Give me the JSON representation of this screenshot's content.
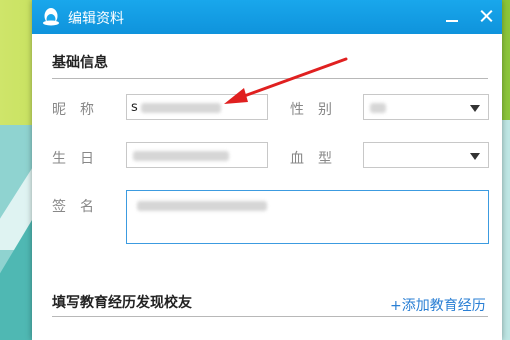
{
  "window": {
    "title": "编辑资料"
  },
  "basic_info": {
    "heading": "基础信息",
    "nickname": {
      "label": "昵　称",
      "value": "s"
    },
    "gender": {
      "label": "性　别"
    },
    "birthday": {
      "label": "生　日"
    },
    "blood_type": {
      "label": "血　型"
    },
    "signature": {
      "label": "签　名"
    }
  },
  "education": {
    "heading": "填写教育经历发现校友",
    "add_link": "+添加教育经历"
  },
  "colors": {
    "titlebar": "#19a7ec",
    "accent_link": "#2a7fd4",
    "annotation_arrow": "#e02020"
  }
}
